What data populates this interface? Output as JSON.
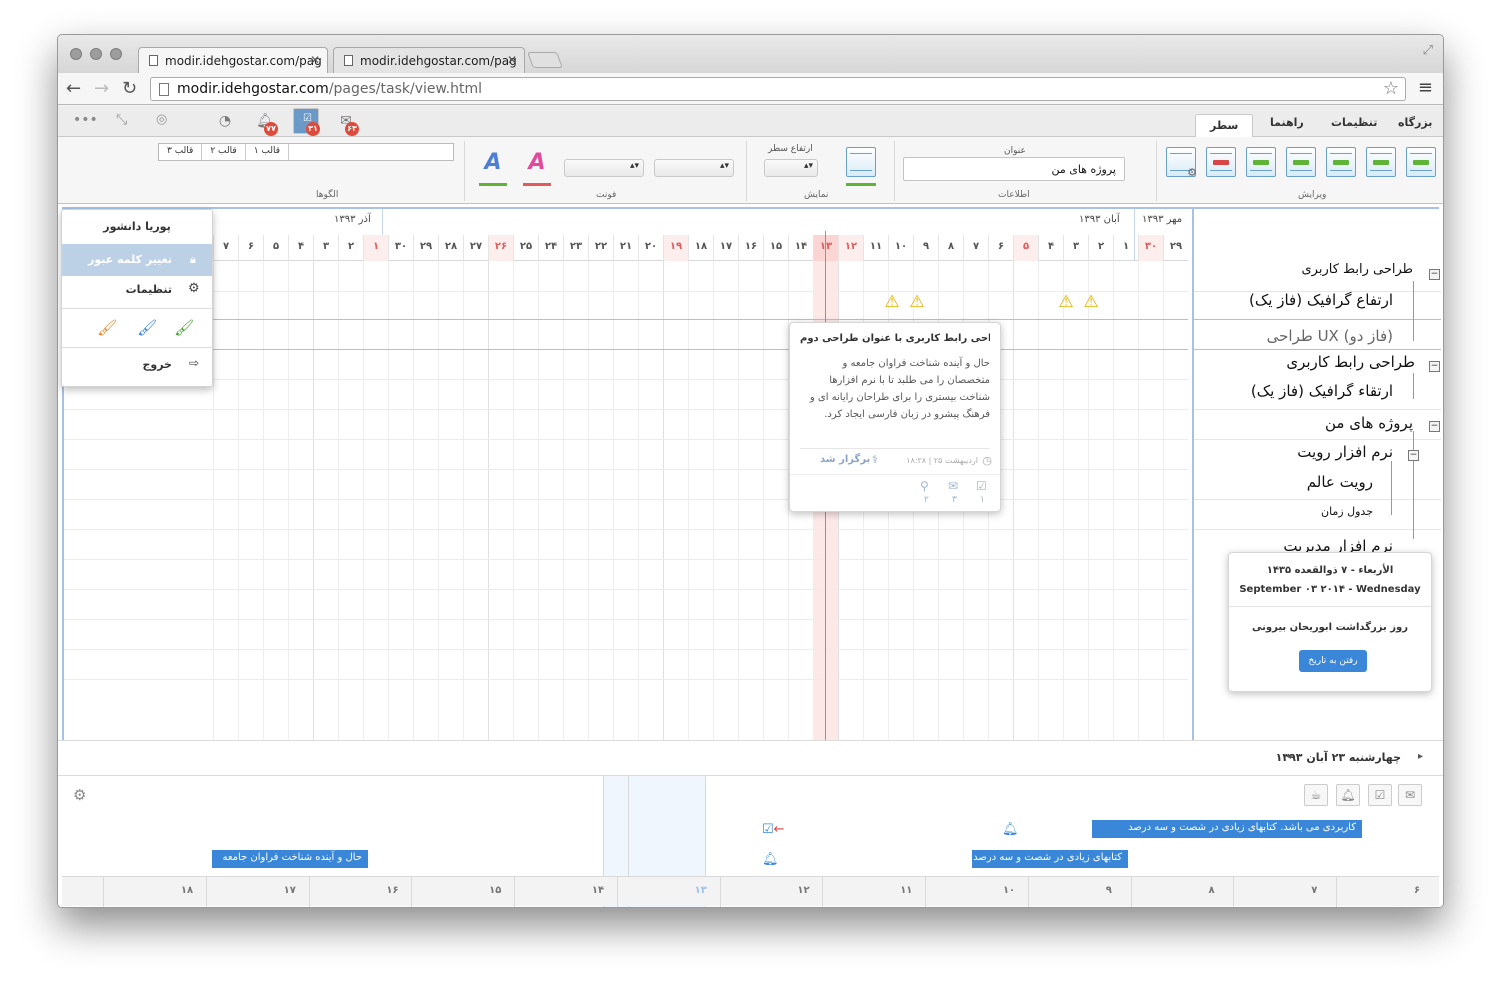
{
  "browser": {
    "tabs": [
      {
        "label": "modir.idehgostar.com/pag"
      },
      {
        "label": "modir.idehgostar.com/pag"
      }
    ],
    "url_host": "modir.idehgostar.com",
    "url_path": "/pages/task/view.html"
  },
  "ribbon": {
    "tabs": {
      "workshop": "بزرگاه",
      "settings": "تنظیمات",
      "guide": "راهنما",
      "row": "سطر"
    },
    "badges": {
      "alerts": "۷۷",
      "tasks": "۳۱",
      "mail": "۶۳"
    },
    "groups": {
      "edit": "ویرایش",
      "info": "اطلاعات",
      "display": "نمایش",
      "font": "فونت",
      "patterns": "الگوها"
    },
    "title_label": "عنوان",
    "title_value": "پروژه های من",
    "row_height_label": "ارتفاع سطر",
    "templates": [
      "قالب ۱",
      "قالب ۲",
      "قالب ۳"
    ]
  },
  "user_menu": {
    "user": "پوریا دانشور",
    "change_password": "تغییر کلمه عبور",
    "settings": "تنظیمات",
    "logout": "خروج",
    "colors": [
      "#4aa63a",
      "#3a87d9",
      "#e8892c"
    ]
  },
  "timeline": {
    "months": {
      "mehr": "مهر ۱۳۹۳",
      "aban": "آبان ۱۳۹۳",
      "azar": "آذر ۱۳۹۳"
    },
    "days": [
      "۲۹",
      "۳۰",
      "۱",
      "۲",
      "۳",
      "۴",
      "۵",
      "۶",
      "۷",
      "۸",
      "۹",
      "۱۰",
      "۱۱",
      "۱۲",
      "۱۳",
      "۱۴",
      "۱۵",
      "۱۶",
      "۱۷",
      "۱۸",
      "۱۹",
      "۲۰",
      "۲۱",
      "۲۲",
      "۲۳",
      "۲۴",
      "۲۵",
      "۲۶",
      "۲۷",
      "۲۸",
      "۲۹",
      "۳۰",
      "۱",
      "۲",
      "۳",
      "۴",
      "۵",
      "۶",
      "۷"
    ]
  },
  "tree": {
    "rows": [
      "طراحی رابط کاربری",
      "ارتفاع گرافیک (فاز یک)",
      "طراحی UX (فاز دو)",
      "طراحی رابط کاربری",
      "ارتقاء گرافیک (فاز یک)",
      "پروژه های من",
      "نرم افزار رویت",
      "رویت عالم",
      "جدول زمان",
      "نرم افزار مدیریت"
    ]
  },
  "task_popup": {
    "title": "طراحی رابط کاربری با عنوان طراحی دوم",
    "body": "حال و آینده شناخت فراوان جامعه و متخصصان را می طلبد تا با نرم افزارها شناخت بیستری را برای طراحان رایانه ای و فرهنگ پیشرو در زبان فارسی ایجاد کرد.",
    "date": "۱۸:۲۸ | ۲۵ اردیبهشت",
    "status": "برگزار شد",
    "counts": [
      "۱",
      "۳",
      "۲"
    ]
  },
  "date_popup": {
    "hijri": "الأربعاء - ۷ ذوالقعده ۱۴۳۵",
    "gregorian": "September ۰۳ ۲۰۱۴ - Wednesday",
    "occasion": "روز بزرگداشت ابوریحان بیرونی",
    "button": "رفتن به تاریخ"
  },
  "datebar": {
    "label": "چهارشنبه ۲۳ آبان ۱۳۹۳"
  },
  "bottom": {
    "events": {
      "e1": "کاربردی می باشد. کتابهای زیادی در شصت و سه درصد",
      "e2": "کتابهای زیادی در شصت و سه درصد",
      "e3": "حال و آینده شناخت فراوان جامعه"
    },
    "scale": [
      "۶",
      "۷",
      "۸",
      "۹",
      "۱۰",
      "۱۱",
      "۱۲",
      "۱۳",
      "۱۴",
      "۱۵",
      "۱۶",
      "۱۷",
      "۱۸"
    ]
  }
}
